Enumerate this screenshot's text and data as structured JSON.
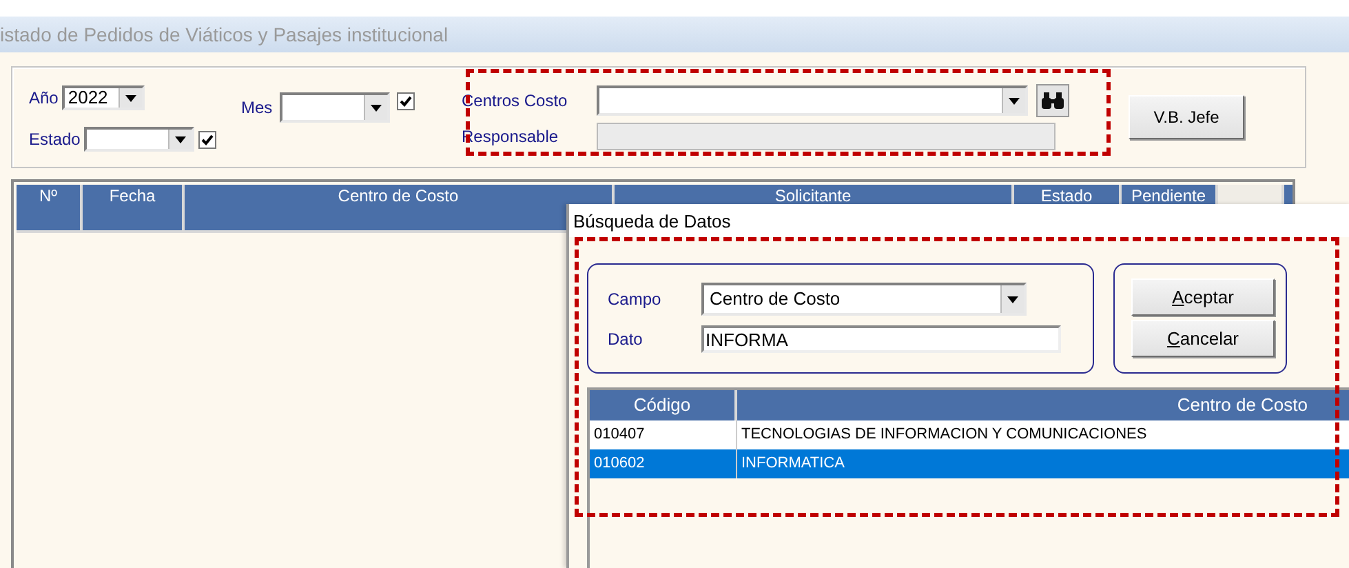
{
  "window": {
    "title": "istado de Pedidos de Viáticos y Pasajes institucional"
  },
  "filters": {
    "year": {
      "label": "Año",
      "value": "2022"
    },
    "month": {
      "label": "Mes",
      "checked": true
    },
    "status": {
      "label": "Estado",
      "checked": true
    },
    "cost_center": {
      "label": "Centros Costo"
    },
    "responsible": {
      "label": "Responsable",
      "disabled": true
    }
  },
  "vb_button": "V.B. Jefe",
  "table": {
    "columns": [
      "Nº",
      "Fecha",
      "Centro de Costo",
      "Solicitante",
      "Estado",
      "Pendiente"
    ]
  },
  "dialog": {
    "title": "Búsqueda de Datos",
    "field": {
      "label": "Campo",
      "value": "Centro de Costo"
    },
    "data": {
      "label": "Dato",
      "value": "INFORMA"
    },
    "buttons": [
      "Aceptar",
      "Cancelar"
    ],
    "results": {
      "columns": [
        "Código",
        "Centro de Costo"
      ],
      "rows": [
        {
          "code": "010407",
          "name": "TECNOLOGIAS DE INFORMACION Y COMUNICACIONES",
          "selected": false
        },
        {
          "code": "010602",
          "name": "INFORMATICA",
          "selected": true
        }
      ]
    }
  }
}
